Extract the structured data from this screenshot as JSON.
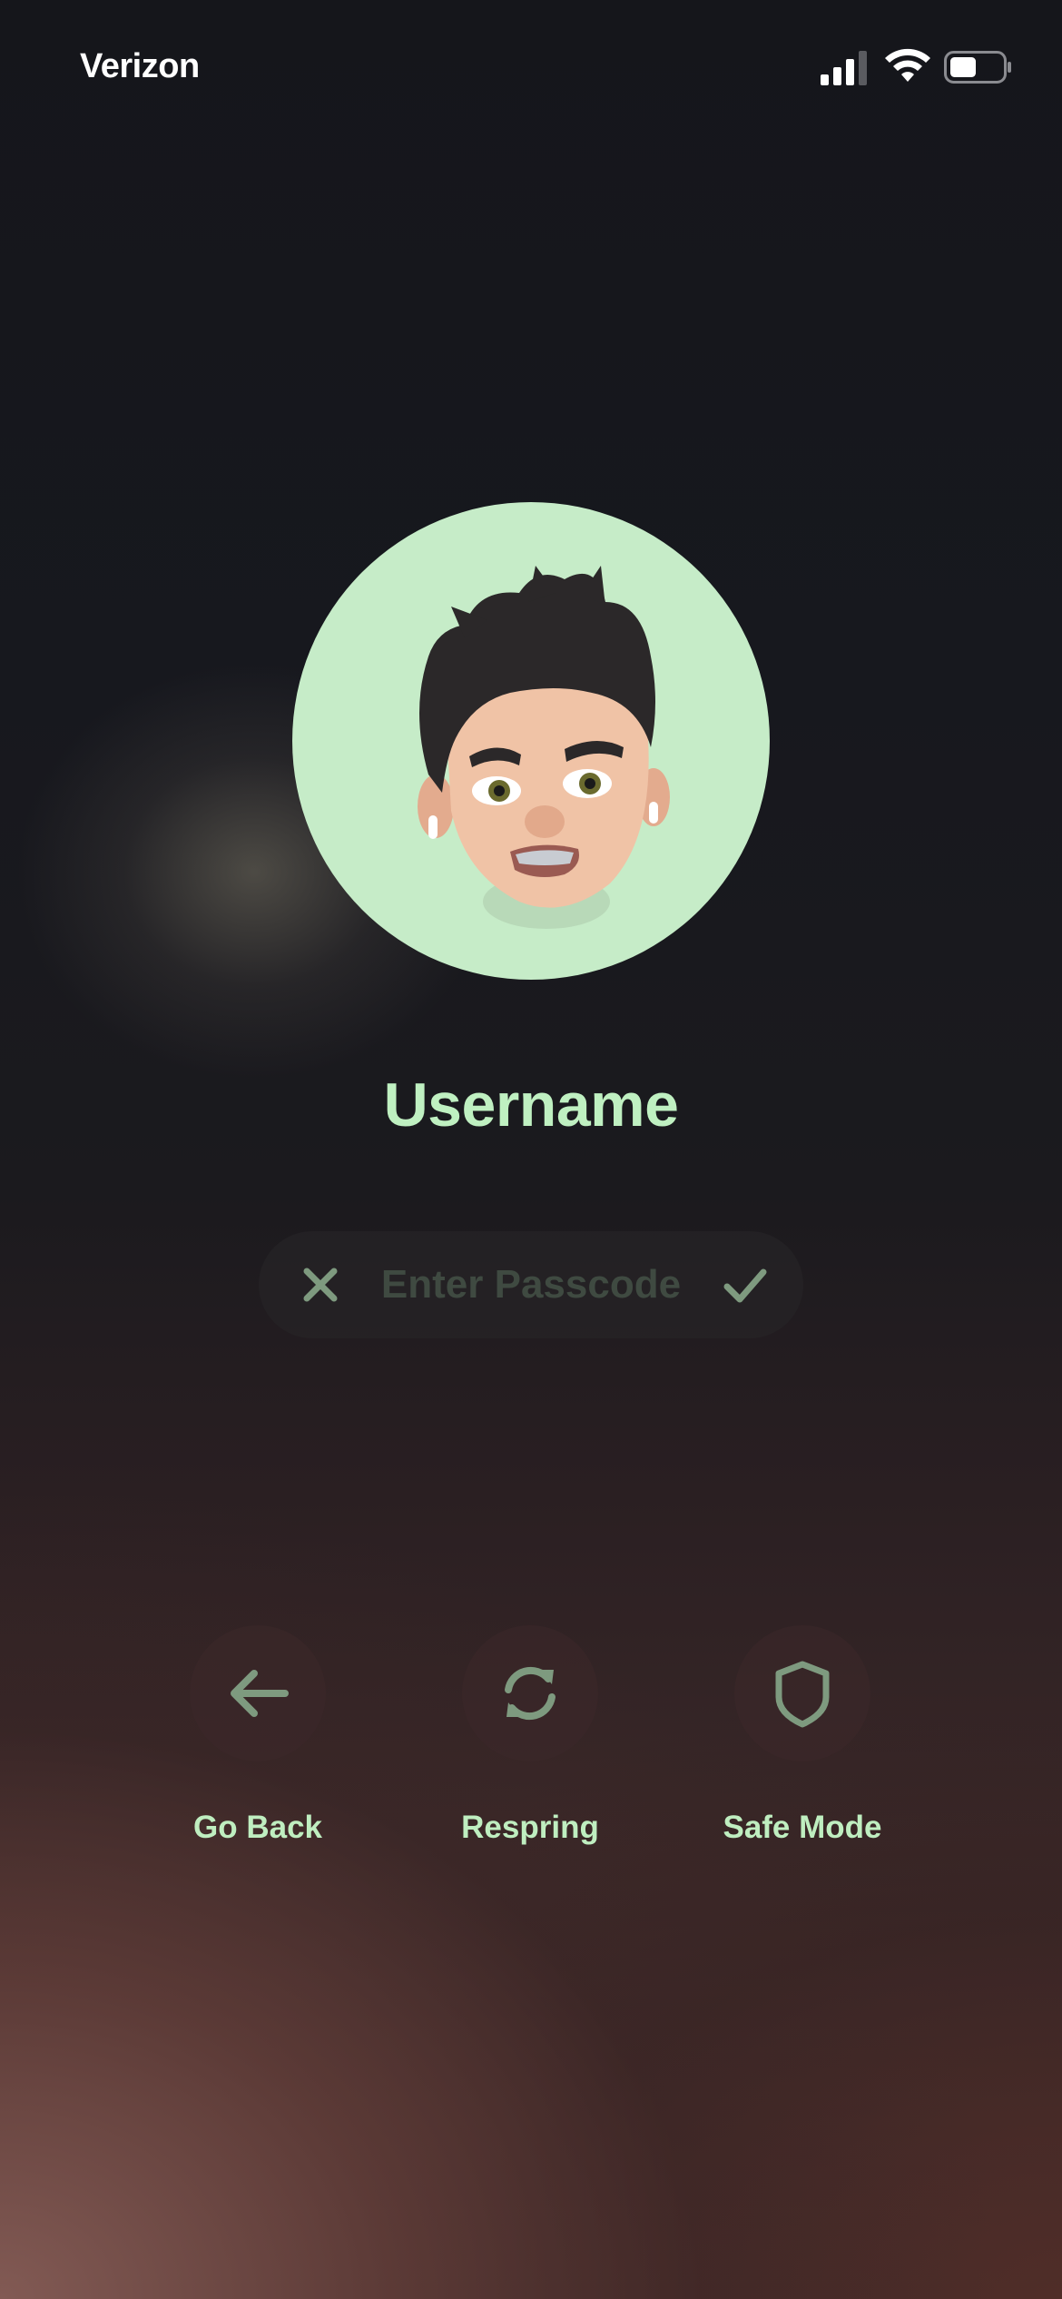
{
  "status_bar": {
    "carrier": "Verizon",
    "signal_icon": "cellular-signal-icon",
    "wifi_icon": "wifi-icon",
    "battery_icon": "battery-icon",
    "battery_level": 0.5
  },
  "profile": {
    "avatar_icon": "memoji-avatar",
    "avatar_background": "#c6ecc8",
    "username": "Username"
  },
  "passcode": {
    "placeholder": "Enter Passcode",
    "value": "",
    "clear_icon": "close-icon",
    "confirm_icon": "checkmark-icon"
  },
  "actions": [
    {
      "label": "Go Back",
      "icon": "arrow-left-icon"
    },
    {
      "label": "Respring",
      "icon": "refresh-icon"
    },
    {
      "label": "Safe Mode",
      "icon": "shield-icon"
    }
  ],
  "colors": {
    "accent": "#bff0c1",
    "icon_muted": "#8aa88b",
    "white": "#ffffff"
  }
}
